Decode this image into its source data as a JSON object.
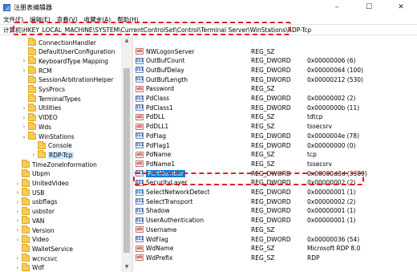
{
  "window": {
    "title": "注册表编辑器",
    "min": "–",
    "max": "☐",
    "close": "✕"
  },
  "menu": [
    "文件(F)",
    "编辑(E)",
    "查看(V)",
    "收藏夹(A)",
    "帮助(H)"
  ],
  "address": "计算机\\HKEY_LOCAL_MACHINE\\SYSTEM\\CurrentControlSet\\Control\\Terminal Server\\WinStations\\RDP-Tcp",
  "tree": [
    {
      "label": "ConnectionHandler",
      "indent": 0
    },
    {
      "label": "DefaultUserConfiguration",
      "indent": 0
    },
    {
      "label": "KeyboardType Mapping",
      "indent": 0,
      "expander": ">"
    },
    {
      "label": "RCM",
      "indent": 0,
      "expander": ">"
    },
    {
      "label": "SessionArbitrationHelper",
      "indent": 0
    },
    {
      "label": "SysProcs",
      "indent": 0
    },
    {
      "label": "TerminalTypes",
      "indent": 0
    },
    {
      "label": "Utilities",
      "indent": 0,
      "expander": ">"
    },
    {
      "label": "VIDEO",
      "indent": 0,
      "expander": ">"
    },
    {
      "label": "Wds",
      "indent": 0,
      "expander": ">"
    },
    {
      "label": "WinStations",
      "indent": 0,
      "expander": "v"
    },
    {
      "label": "Console",
      "indent": 1
    },
    {
      "label": "RDP-Tcp",
      "indent": 1,
      "expander": ">",
      "selected": true
    },
    {
      "label": "TimeZoneInformation",
      "indent": -1
    },
    {
      "label": "Ubpm",
      "indent": -1
    },
    {
      "label": "UnitedVideo",
      "indent": -1,
      "expander": ">"
    },
    {
      "label": "USB",
      "indent": -1,
      "expander": ">"
    },
    {
      "label": "usbflags",
      "indent": -1,
      "expander": ">"
    },
    {
      "label": "usbstor",
      "indent": -1,
      "expander": ">"
    },
    {
      "label": "VAN",
      "indent": -1,
      "expander": ">"
    },
    {
      "label": "Version",
      "indent": -1,
      "expander": ">"
    },
    {
      "label": "Video",
      "indent": -1,
      "expander": ">"
    },
    {
      "label": "WalletService",
      "indent": -1
    },
    {
      "label": "wcncsvc",
      "indent": -1,
      "expander": ">"
    },
    {
      "label": "Wdf",
      "indent": -1,
      "expander": ">"
    }
  ],
  "values": [
    {
      "name": "NWLogonServer",
      "type": "REG_SZ",
      "data": "",
      "icon": "str"
    },
    {
      "name": "OutBufCount",
      "type": "REG_DWORD",
      "data": "0x00000006 (6)",
      "icon": "bin"
    },
    {
      "name": "OutBufDelay",
      "type": "REG_DWORD",
      "data": "0x00000064 (100)",
      "icon": "bin"
    },
    {
      "name": "OutBufLength",
      "type": "REG_DWORD",
      "data": "0x00000212 (530)",
      "icon": "bin"
    },
    {
      "name": "Password",
      "type": "REG_SZ",
      "data": "",
      "icon": "str"
    },
    {
      "name": "PdClass",
      "type": "REG_DWORD",
      "data": "0x00000002 (2)",
      "icon": "bin"
    },
    {
      "name": "PdClass1",
      "type": "REG_DWORD",
      "data": "0x0000000b (11)",
      "icon": "bin"
    },
    {
      "name": "PdDLL",
      "type": "REG_SZ",
      "data": "tdtcp",
      "icon": "str"
    },
    {
      "name": "PdDLL1",
      "type": "REG_SZ",
      "data": "tssecsrv",
      "icon": "str"
    },
    {
      "name": "PdFlag",
      "type": "REG_DWORD",
      "data": "0x0000004e (78)",
      "icon": "bin"
    },
    {
      "name": "PdFlag1",
      "type": "REG_DWORD",
      "data": "0x00000000 (0)",
      "icon": "bin"
    },
    {
      "name": "PdName",
      "type": "REG_SZ",
      "data": "tcp",
      "icon": "str"
    },
    {
      "name": "PdName1",
      "type": "REG_SZ",
      "data": "tssecsrv",
      "icon": "str"
    },
    {
      "name": "PortNumber",
      "type": "REG_DWORD",
      "data": "0x00000d3d (3389)",
      "icon": "bin",
      "selected": true
    },
    {
      "name": "SecurityLayer",
      "type": "REG_DWORD",
      "data": "0x00000002 (2)",
      "icon": "bin"
    },
    {
      "name": "SelectNetworkDetect",
      "type": "REG_DWORD",
      "data": "0x00000001 (1)",
      "icon": "bin"
    },
    {
      "name": "SelectTransport",
      "type": "REG_DWORD",
      "data": "0x00000002 (2)",
      "icon": "bin"
    },
    {
      "name": "Shadow",
      "type": "REG_DWORD",
      "data": "0x00000001 (1)",
      "icon": "bin"
    },
    {
      "name": "UserAuthentication",
      "type": "REG_DWORD",
      "data": "0x00000001 (1)",
      "icon": "bin"
    },
    {
      "name": "Username",
      "type": "REG_SZ",
      "data": "",
      "icon": "str"
    },
    {
      "name": "WdFlag",
      "type": "REG_DWORD",
      "data": "0x00000036 (54)",
      "icon": "bin"
    },
    {
      "name": "WdName",
      "type": "REG_SZ",
      "data": "Microsoft RDP 8.0",
      "icon": "str"
    },
    {
      "name": "WdPrefix",
      "type": "REG_SZ",
      "data": "RDP",
      "icon": "str"
    }
  ]
}
